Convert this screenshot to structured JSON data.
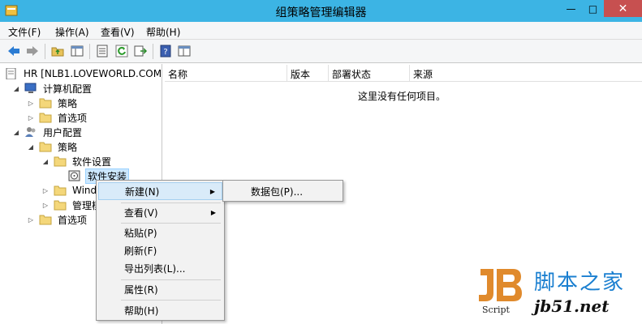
{
  "window": {
    "title": "组策略管理编辑器",
    "min_glyph": "—",
    "max_glyph": "□",
    "close_glyph": "✕"
  },
  "menubar": [
    "文件(F)",
    "操作(A)",
    "查看(V)",
    "帮助(H)"
  ],
  "tree": {
    "root": "HR [NLB1.LOVEWORLD.COM",
    "computer_config": "计算机配置",
    "policies_1": "策略",
    "preferences_1": "首选项",
    "user_config": "用户配置",
    "policies_2": "策略",
    "software_settings": "软件设置",
    "software_install": "软件安装",
    "windows_settings": "Wind",
    "admin_templates": "管理模",
    "preferences_2": "首选项"
  },
  "list": {
    "columns": [
      "名称",
      "版本",
      "部署状态",
      "来源"
    ],
    "empty_message": "这里没有任何项目。"
  },
  "context_menu": {
    "new": "新建(N)",
    "view": "查看(V)",
    "paste": "粘贴(P)",
    "refresh": "刷新(F)",
    "export": "导出列表(L)...",
    "properties": "属性(R)",
    "help": "帮助(H)"
  },
  "submenu": {
    "package": "数据包(P)..."
  },
  "watermark": {
    "logo_text": "JB",
    "script_text": "Script",
    "site_cn": "脚本之家",
    "url": "jb51.net"
  },
  "colors": {
    "titlebar": "#3cb4e4",
    "close": "#c75050",
    "hover": "#d9ebf9",
    "watermark_blue": "#1a7fd0",
    "logo_orange": "#e08a2c"
  }
}
